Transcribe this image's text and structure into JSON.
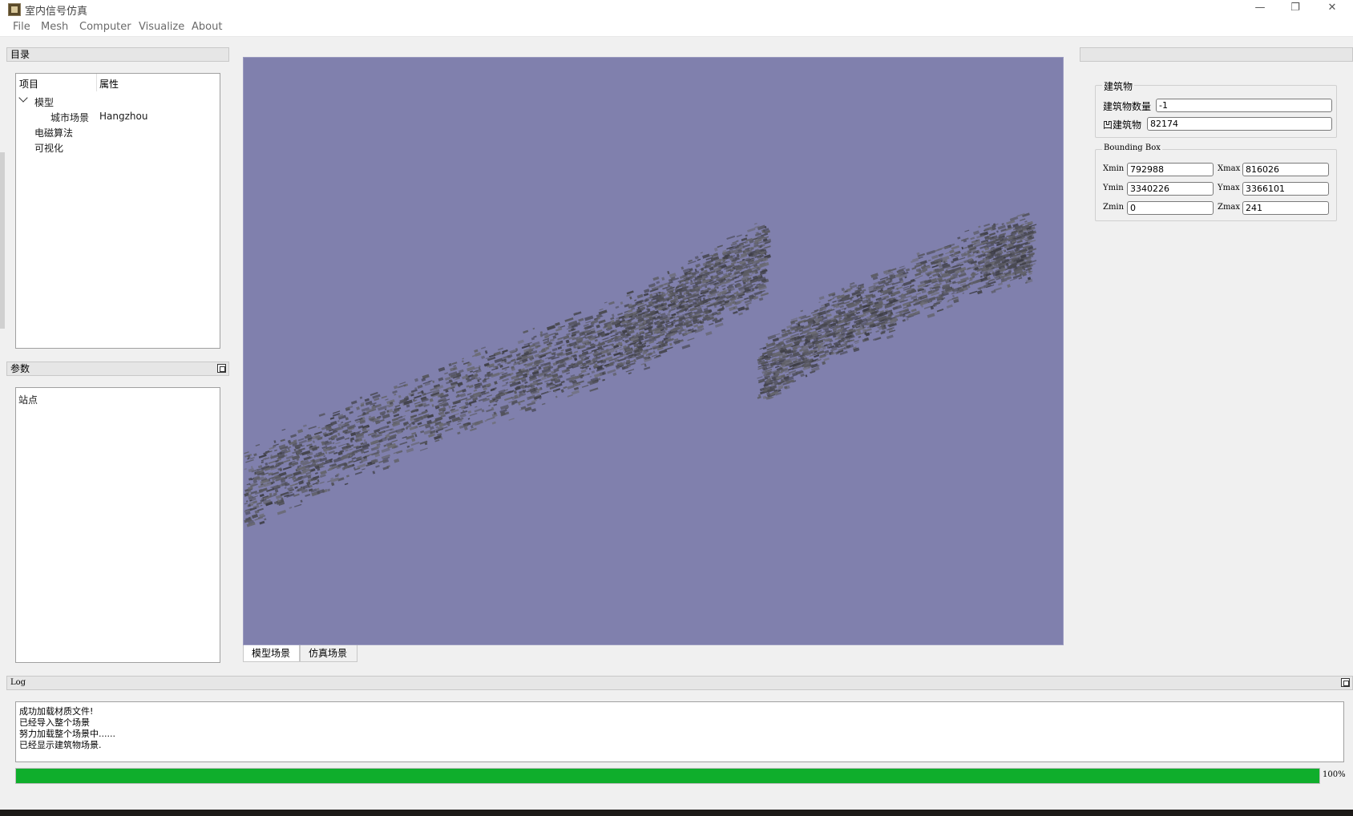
{
  "window": {
    "title": "室内信号仿真",
    "minimize": "—",
    "restore": "❐",
    "close": "✕"
  },
  "menu": [
    "File",
    "Mesh",
    "Computer",
    "Visualize",
    "About"
  ],
  "catalog": {
    "title": "目录",
    "headers": [
      "项目",
      "属性"
    ],
    "items": [
      {
        "label": "模型",
        "value": ""
      },
      {
        "label": "城市场景",
        "value": "Hangzhou"
      },
      {
        "label": "电磁算法",
        "value": ""
      },
      {
        "label": "可视化",
        "value": ""
      }
    ]
  },
  "params": {
    "title": "参数",
    "items": [
      "站点"
    ]
  },
  "viewport": {
    "tabs": [
      "模型场景",
      "仿真场景"
    ],
    "active_tab": 0,
    "background": "#8080ad"
  },
  "building": {
    "group_title": "建筑物",
    "count_label": "建筑物数量",
    "count_value": "-1",
    "concave_label": "凹建筑物",
    "concave_value": "82174"
  },
  "bbox": {
    "group_title": "Bounding Box",
    "xmin_label": "Xmin",
    "xmin": "792988",
    "xmax_label": "Xmax",
    "xmax": "816026",
    "ymin_label": "Ymin",
    "ymin": "3340226",
    "ymax_label": "Ymax",
    "ymax": "3366101",
    "zmin_label": "Zmin",
    "zmin": "0",
    "zmax_label": "Zmax",
    "zmax": "241"
  },
  "log": {
    "title": "Log",
    "lines": [
      "成功加载材质文件!",
      "已经导入整个场景",
      "努力加载整个场景中......",
      "已经显示建筑物场景."
    ]
  },
  "progress": {
    "value": 100,
    "label": "100%",
    "color": "#0fae2c"
  }
}
